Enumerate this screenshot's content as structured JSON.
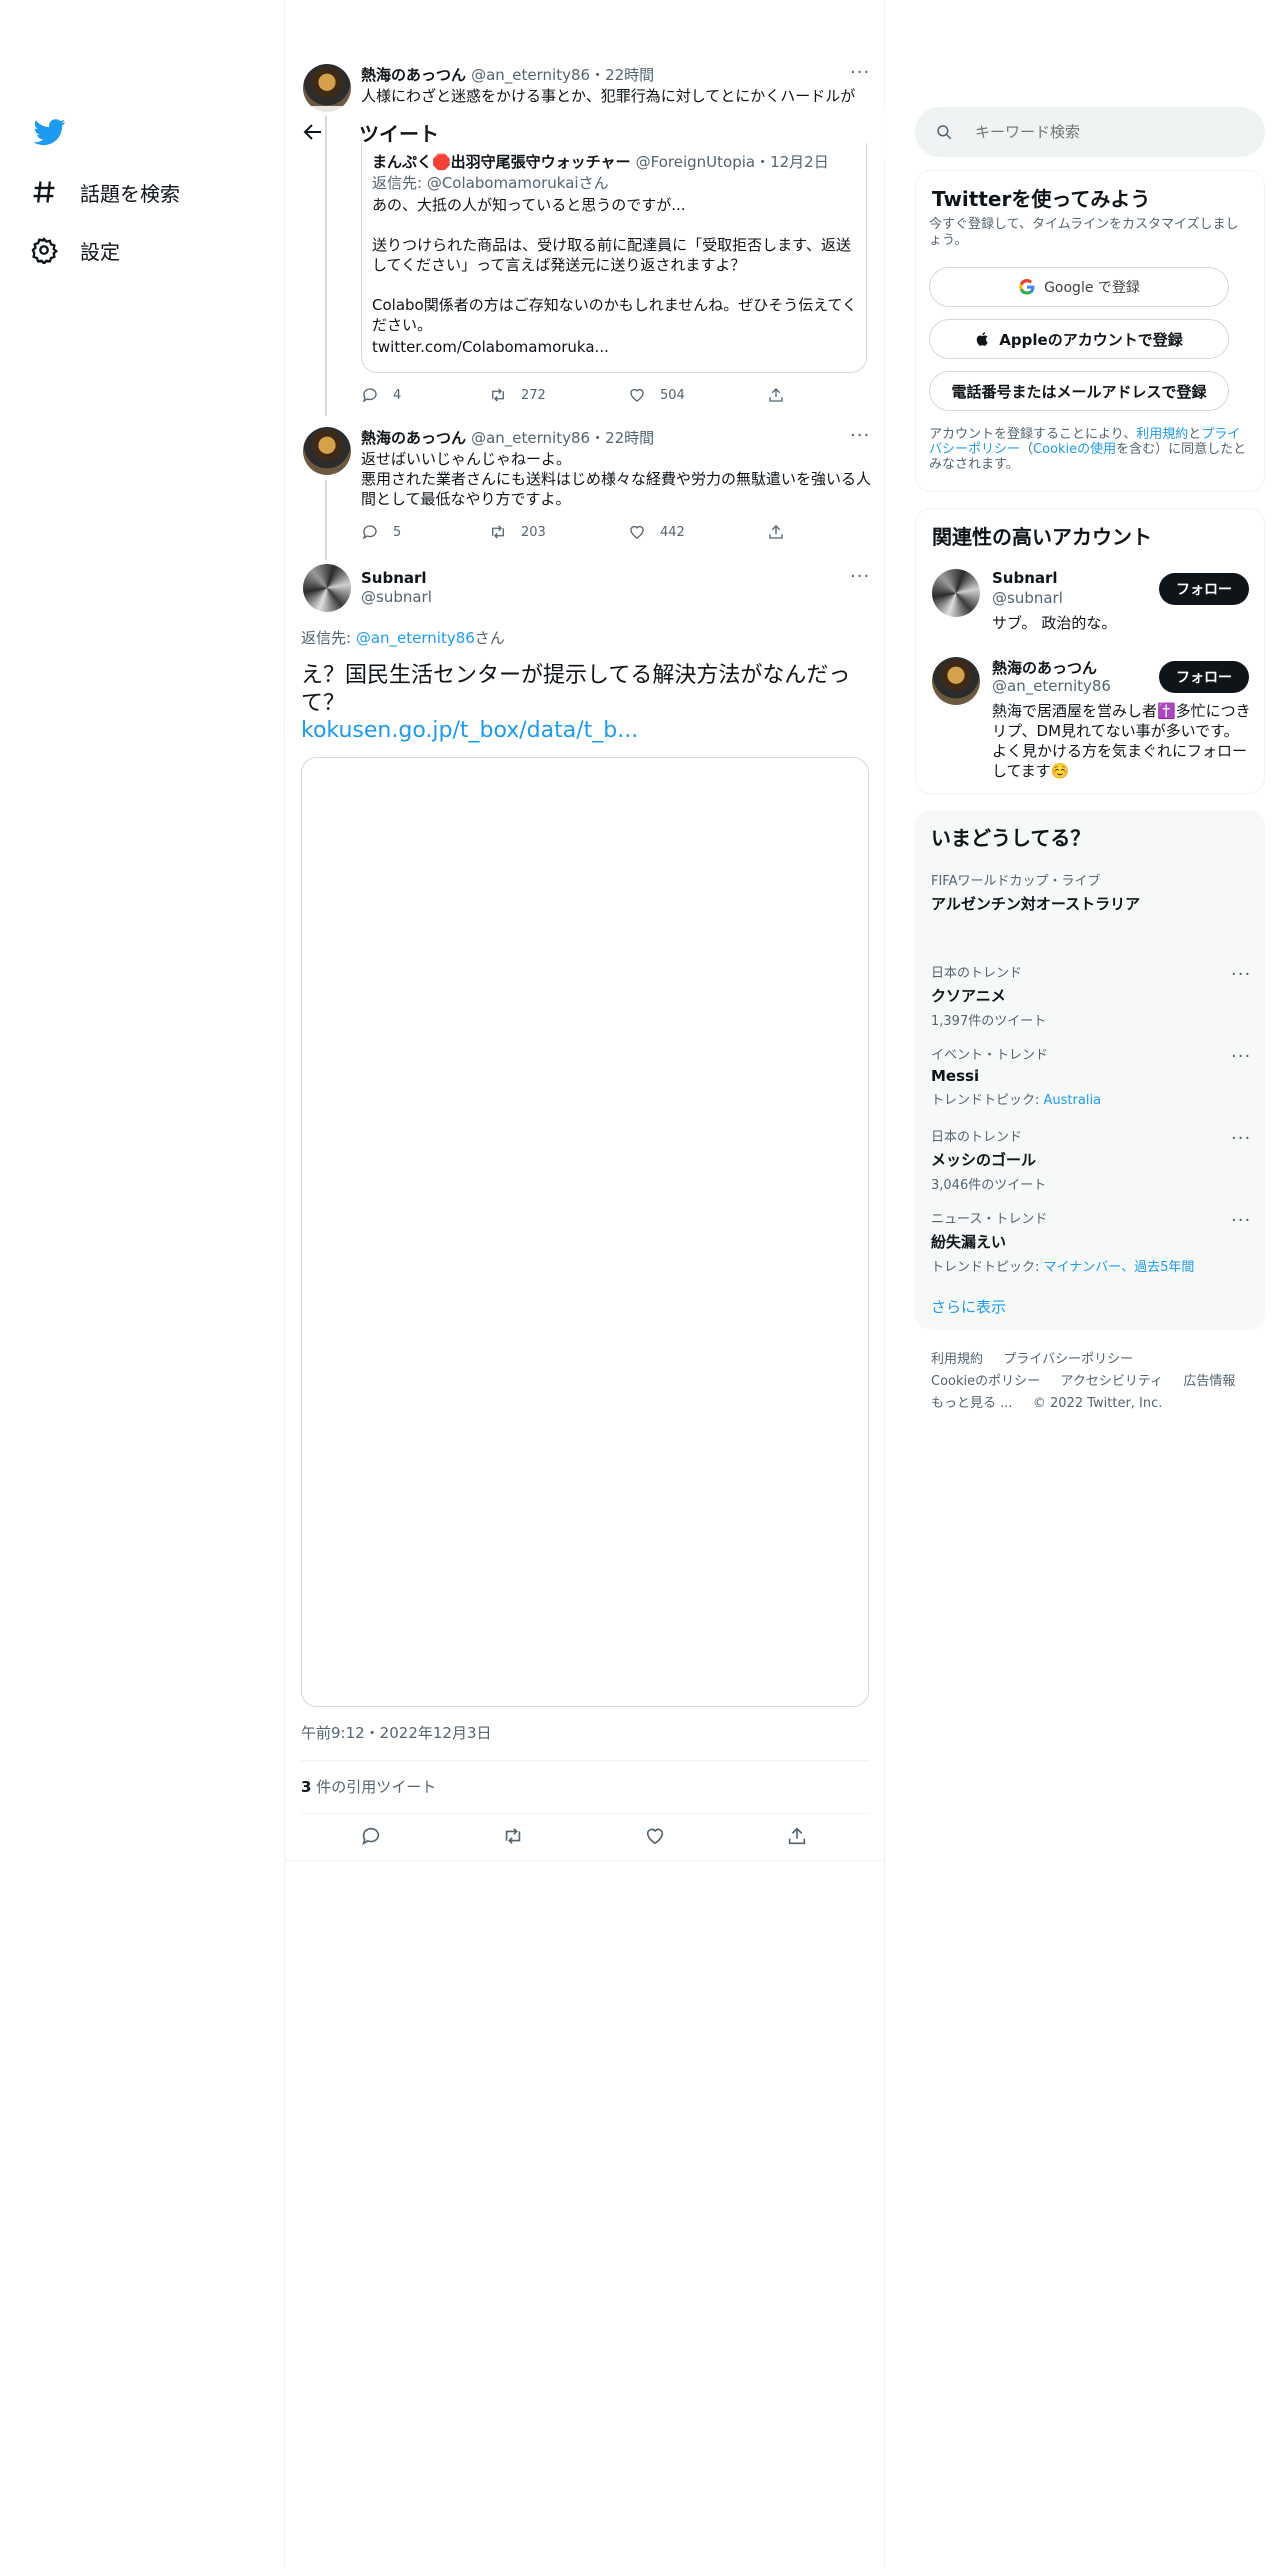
{
  "nav": {
    "items": [
      {
        "label": "話題を検索",
        "icon": "hashtag-icon"
      },
      {
        "label": "設定",
        "icon": "gear-icon"
      }
    ]
  },
  "header": {
    "title": "ツイート"
  },
  "tweet1": {
    "name": "熱海のあっつん",
    "handle": "@an_eternity86",
    "time": "・22時間",
    "text": "人様にわざと迷惑をかける事とか、犯罪行為に対してとにかくハードルが",
    "quote": {
      "name": "まんぷく🛑出羽守尾張守ウォッチャー",
      "handle": "@ForeignUtopia",
      "time": "・12月2日",
      "reply_prefix": "返信先: ",
      "reply_to": "@Colabomamorukai",
      "reply_suffix": "さん",
      "lines": [
        "あの、大抵の人が知っていると思うのですが...",
        "送りつけられた商品は、受け取る前に配達員に「受取拒否します、返送してください」って言えば発送元に送り返されますよ？",
        "Colabo関係者の方はご存知ないのかもしれませんね。ぜひそう伝えてください。",
        "twitter.com/Colabomamoruka..."
      ]
    },
    "replies": "4",
    "retweets": "272",
    "likes": "504"
  },
  "tweet2": {
    "name": "熱海のあっつん",
    "handle": "@an_eternity86",
    "time": "・22時間",
    "line1": "返せばいいじゃんじゃねーよ。",
    "line2": "悪用された業者さんにも送料はじめ様々な経費や労力の無駄遣いを強いる人間として最低なやり方ですよ。",
    "replies": "5",
    "retweets": "203",
    "likes": "442"
  },
  "main_tweet": {
    "name": "Subnarl",
    "handle": "@subnarl",
    "reply_prefix": "返信先: ",
    "reply_to": "@an_eternity86",
    "reply_suffix": "さん",
    "text": "え？国民生活センターが提示してる解決方法がなんだって？",
    "link": "kokusen.go.jp/t_box/data/t_b...",
    "timestamp": "午前9:12・2022年12月3日",
    "quote_count": "3",
    "quote_label": " 件の引用ツイート"
  },
  "sidebar": {
    "search_placeholder": "キーワード検索",
    "signup": {
      "title": "Twitterを使ってみよう",
      "subtitle": "今すぐ登録して、タイムラインをカスタマイズしましょう。",
      "google": "Google で登録",
      "apple": "Appleのアカウントで登録",
      "phone": "電話番号またはメールアドレスで登録",
      "terms_prefix": "アカウントを登録することにより、",
      "terms_link": "利用規約",
      "terms_and": "と",
      "privacy_link": "プライバシーポリシー",
      "cookie_open": "（",
      "cookie_link": "Cookieの使用",
      "cookie_suffix": "を含む）に同意したとみなされます。"
    },
    "related": {
      "title": "関連性の高いアカウント",
      "follow_label": "フォロー",
      "accounts": [
        {
          "name": "Subnarl",
          "handle": "@subnarl",
          "bio": "サブ。 政治的な。"
        },
        {
          "name": "熱海のあっつん",
          "handle": "@an_eternity86",
          "bio": "熱海で居酒屋を営みし者✝️多忙につきリプ、DM見れてない事が多いです。よく見かける方を気まぐれにフォローしてます☺️"
        }
      ]
    },
    "trends": {
      "title": "いまどうしてる？",
      "items": [
        {
          "category": "FIFAワールドカップ・ライブ",
          "name": "アルゼンチン対オーストラリア",
          "meta": "",
          "meta_link": ""
        },
        {
          "category": "日本のトレンド",
          "name": "クソアニメ",
          "meta": "1,397件のツイート",
          "meta_link": ""
        },
        {
          "category": "イベント・トレンド",
          "name": "Messi",
          "meta": "トレンドトピック: ",
          "meta_link": "Australia"
        },
        {
          "category": "日本のトレンド",
          "name": "メッシのゴール",
          "meta": "3,046件のツイート",
          "meta_link": ""
        },
        {
          "category": "ニュース・トレンド",
          "name": "紛失漏えい",
          "meta": "トレンドトピック: ",
          "meta_link": "マイナンバー、過去5年間"
        }
      ],
      "show_more": "さらに表示"
    },
    "footer": {
      "links": [
        "利用規約",
        "プライバシーポリシー",
        "Cookieのポリシー",
        "アクセシビリティ",
        "広告情報",
        "もっと見る ...",
        "© 2022 Twitter, Inc."
      ]
    }
  },
  "colors": {
    "accent": "#1d9bf0",
    "text": "#0f1419",
    "secondary": "#536471",
    "border": "#eff3f4"
  }
}
